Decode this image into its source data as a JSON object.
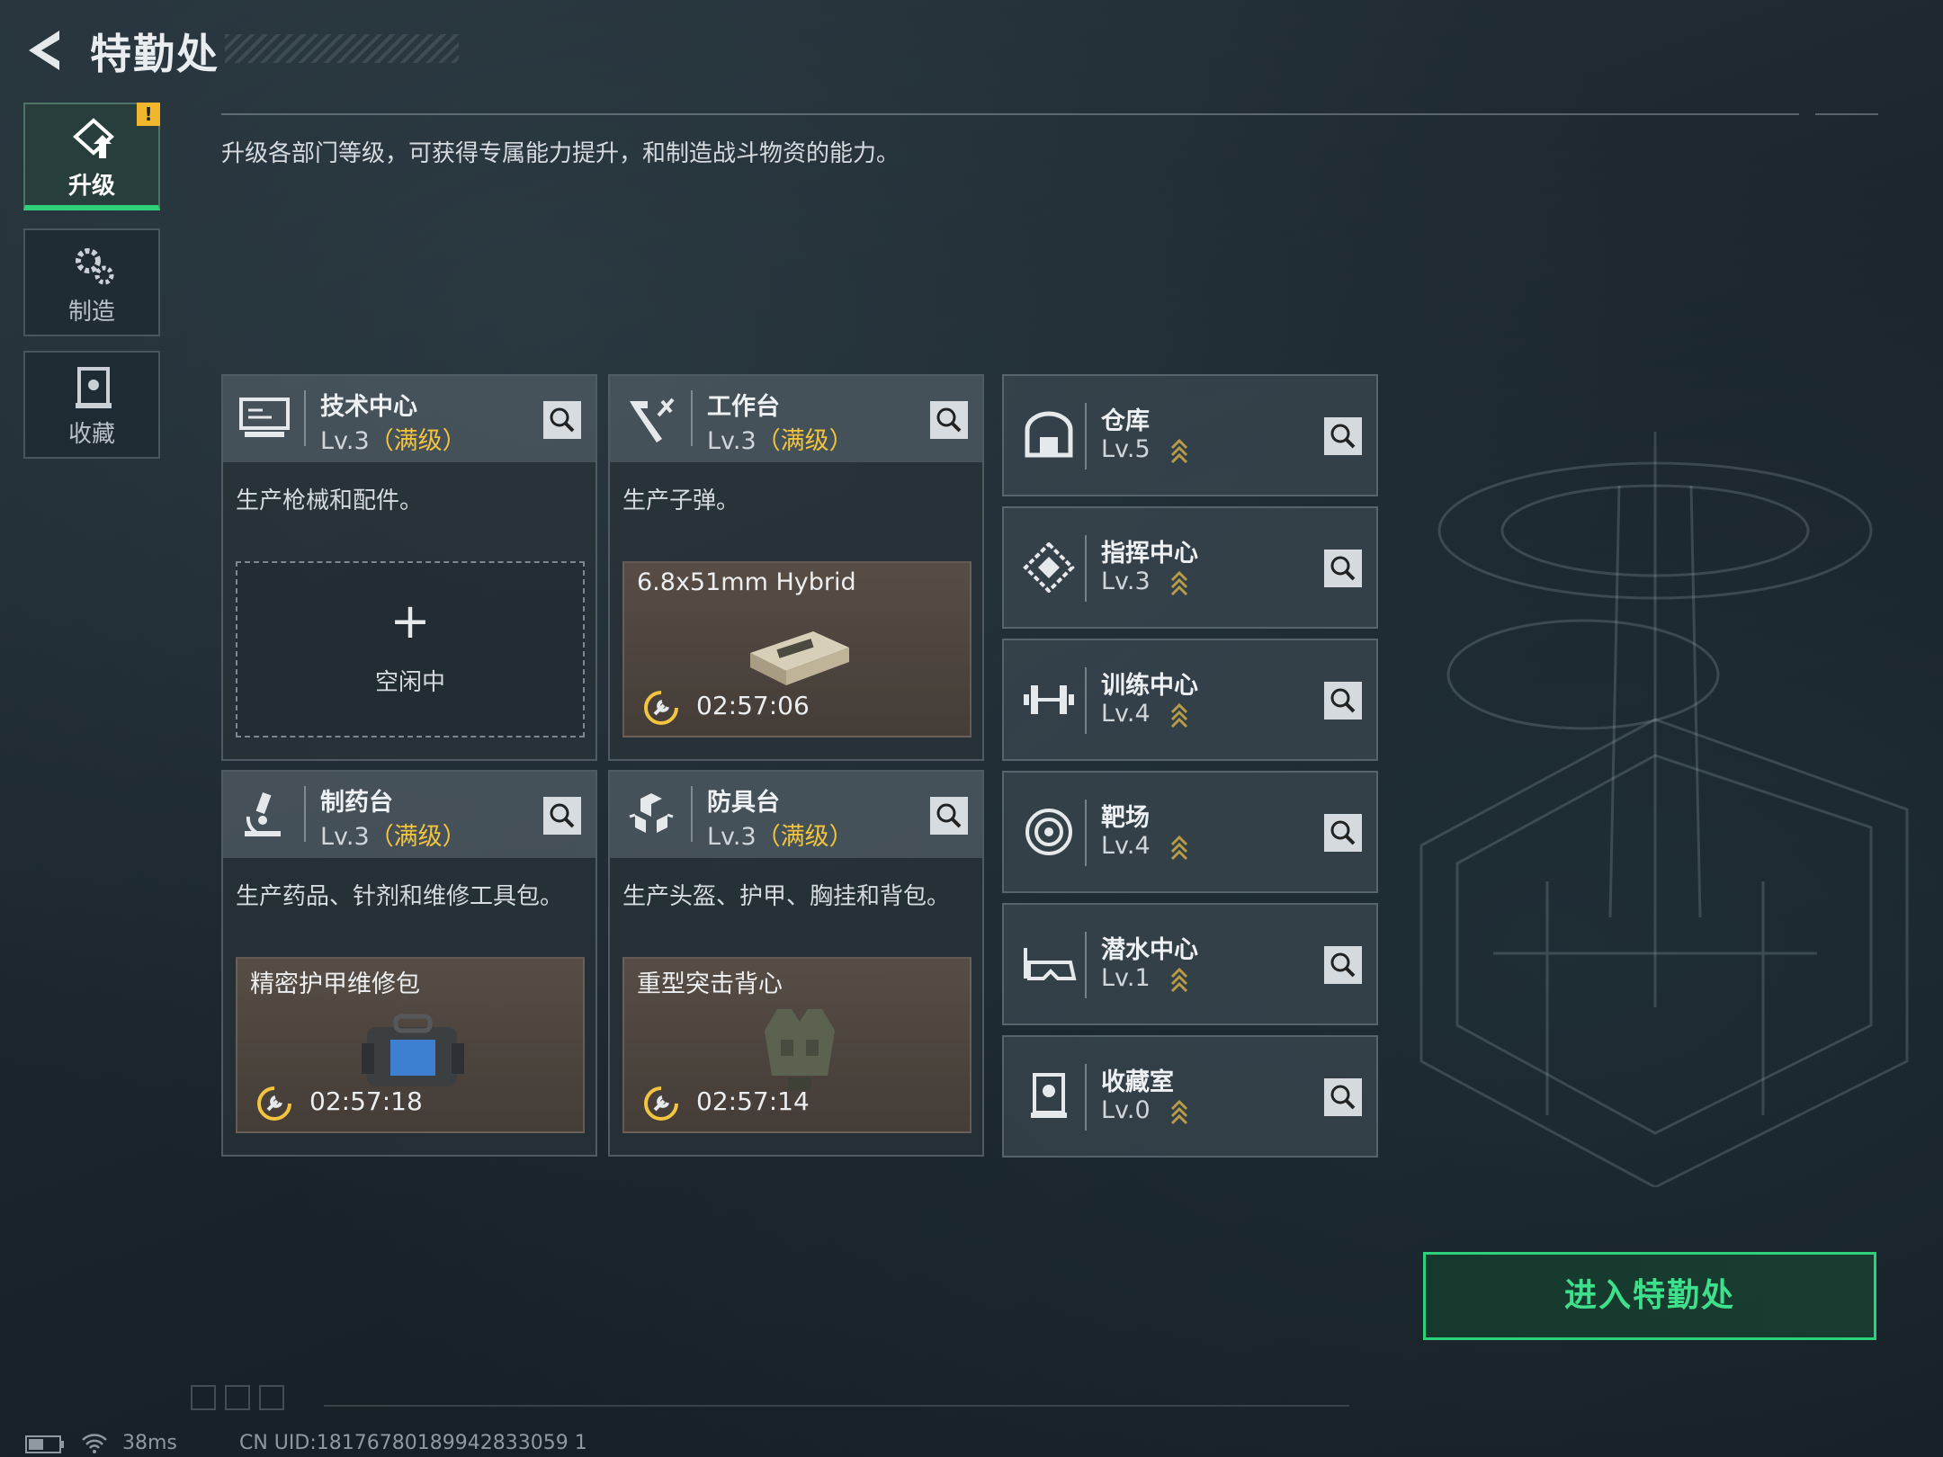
{
  "header": {
    "title": "特勤处",
    "description": "升级各部门等级，可获得专属能力提升，和制造战斗物资的能力。"
  },
  "nav": [
    {
      "label": "升级",
      "icon": "upgrade-icon",
      "active": true,
      "alert": "!"
    },
    {
      "label": "制造",
      "icon": "gears-icon",
      "active": false
    },
    {
      "label": "收藏",
      "icon": "collection-icon",
      "active": false
    }
  ],
  "stations": [
    {
      "name": "技术中心",
      "level": "Lv.3",
      "max_tag": "（满级）",
      "desc": "生产枪械和配件。",
      "icon": "monitor-icon",
      "slot": {
        "state": "idle",
        "plus": "+",
        "text": "空闲中"
      }
    },
    {
      "name": "工作台",
      "level": "Lv.3",
      "max_tag": "（满级）",
      "desc": "生产子弹。",
      "icon": "hammer-icon",
      "slot": {
        "state": "busy",
        "item": "6.8x51mm Hybrid",
        "timer": "02:57:06",
        "item_icon": "ammo-box-icon"
      }
    },
    {
      "name": "制药台",
      "level": "Lv.3",
      "max_tag": "（满级）",
      "desc": "生产药品、针剂和维修工具包。",
      "icon": "microscope-icon",
      "slot": {
        "state": "busy",
        "item": "精密护甲维修包",
        "timer": "02:57:18",
        "item_icon": "repair-kit-icon"
      }
    },
    {
      "name": "防具台",
      "level": "Lv.3",
      "max_tag": "（满级）",
      "desc": "生产头盔、护甲、胸挂和背包。",
      "icon": "cubes-icon",
      "slot": {
        "state": "busy",
        "item": "重型突击背心",
        "timer": "02:57:14",
        "item_icon": "vest-icon"
      }
    }
  ],
  "facilities": [
    {
      "name": "仓库",
      "level": "Lv.5",
      "icon": "warehouse-icon"
    },
    {
      "name": "指挥中心",
      "level": "Lv.3",
      "icon": "command-icon"
    },
    {
      "name": "训练中心",
      "level": "Lv.4",
      "icon": "dumbbell-icon"
    },
    {
      "name": "靶场",
      "level": "Lv.4",
      "icon": "target-icon"
    },
    {
      "name": "潜水中心",
      "level": "Lv.1",
      "icon": "diving-mask-icon"
    },
    {
      "name": "收藏室",
      "level": "Lv.0",
      "icon": "collection-icon"
    }
  ],
  "enter_button": "进入特勤处",
  "footer": {
    "ping": "38ms",
    "uid": "CN UID:18176780189942833059 1"
  },
  "colors": {
    "accent_green": "#2fd07a",
    "max_level": "#f2c440",
    "alert": "#f0b72c"
  }
}
